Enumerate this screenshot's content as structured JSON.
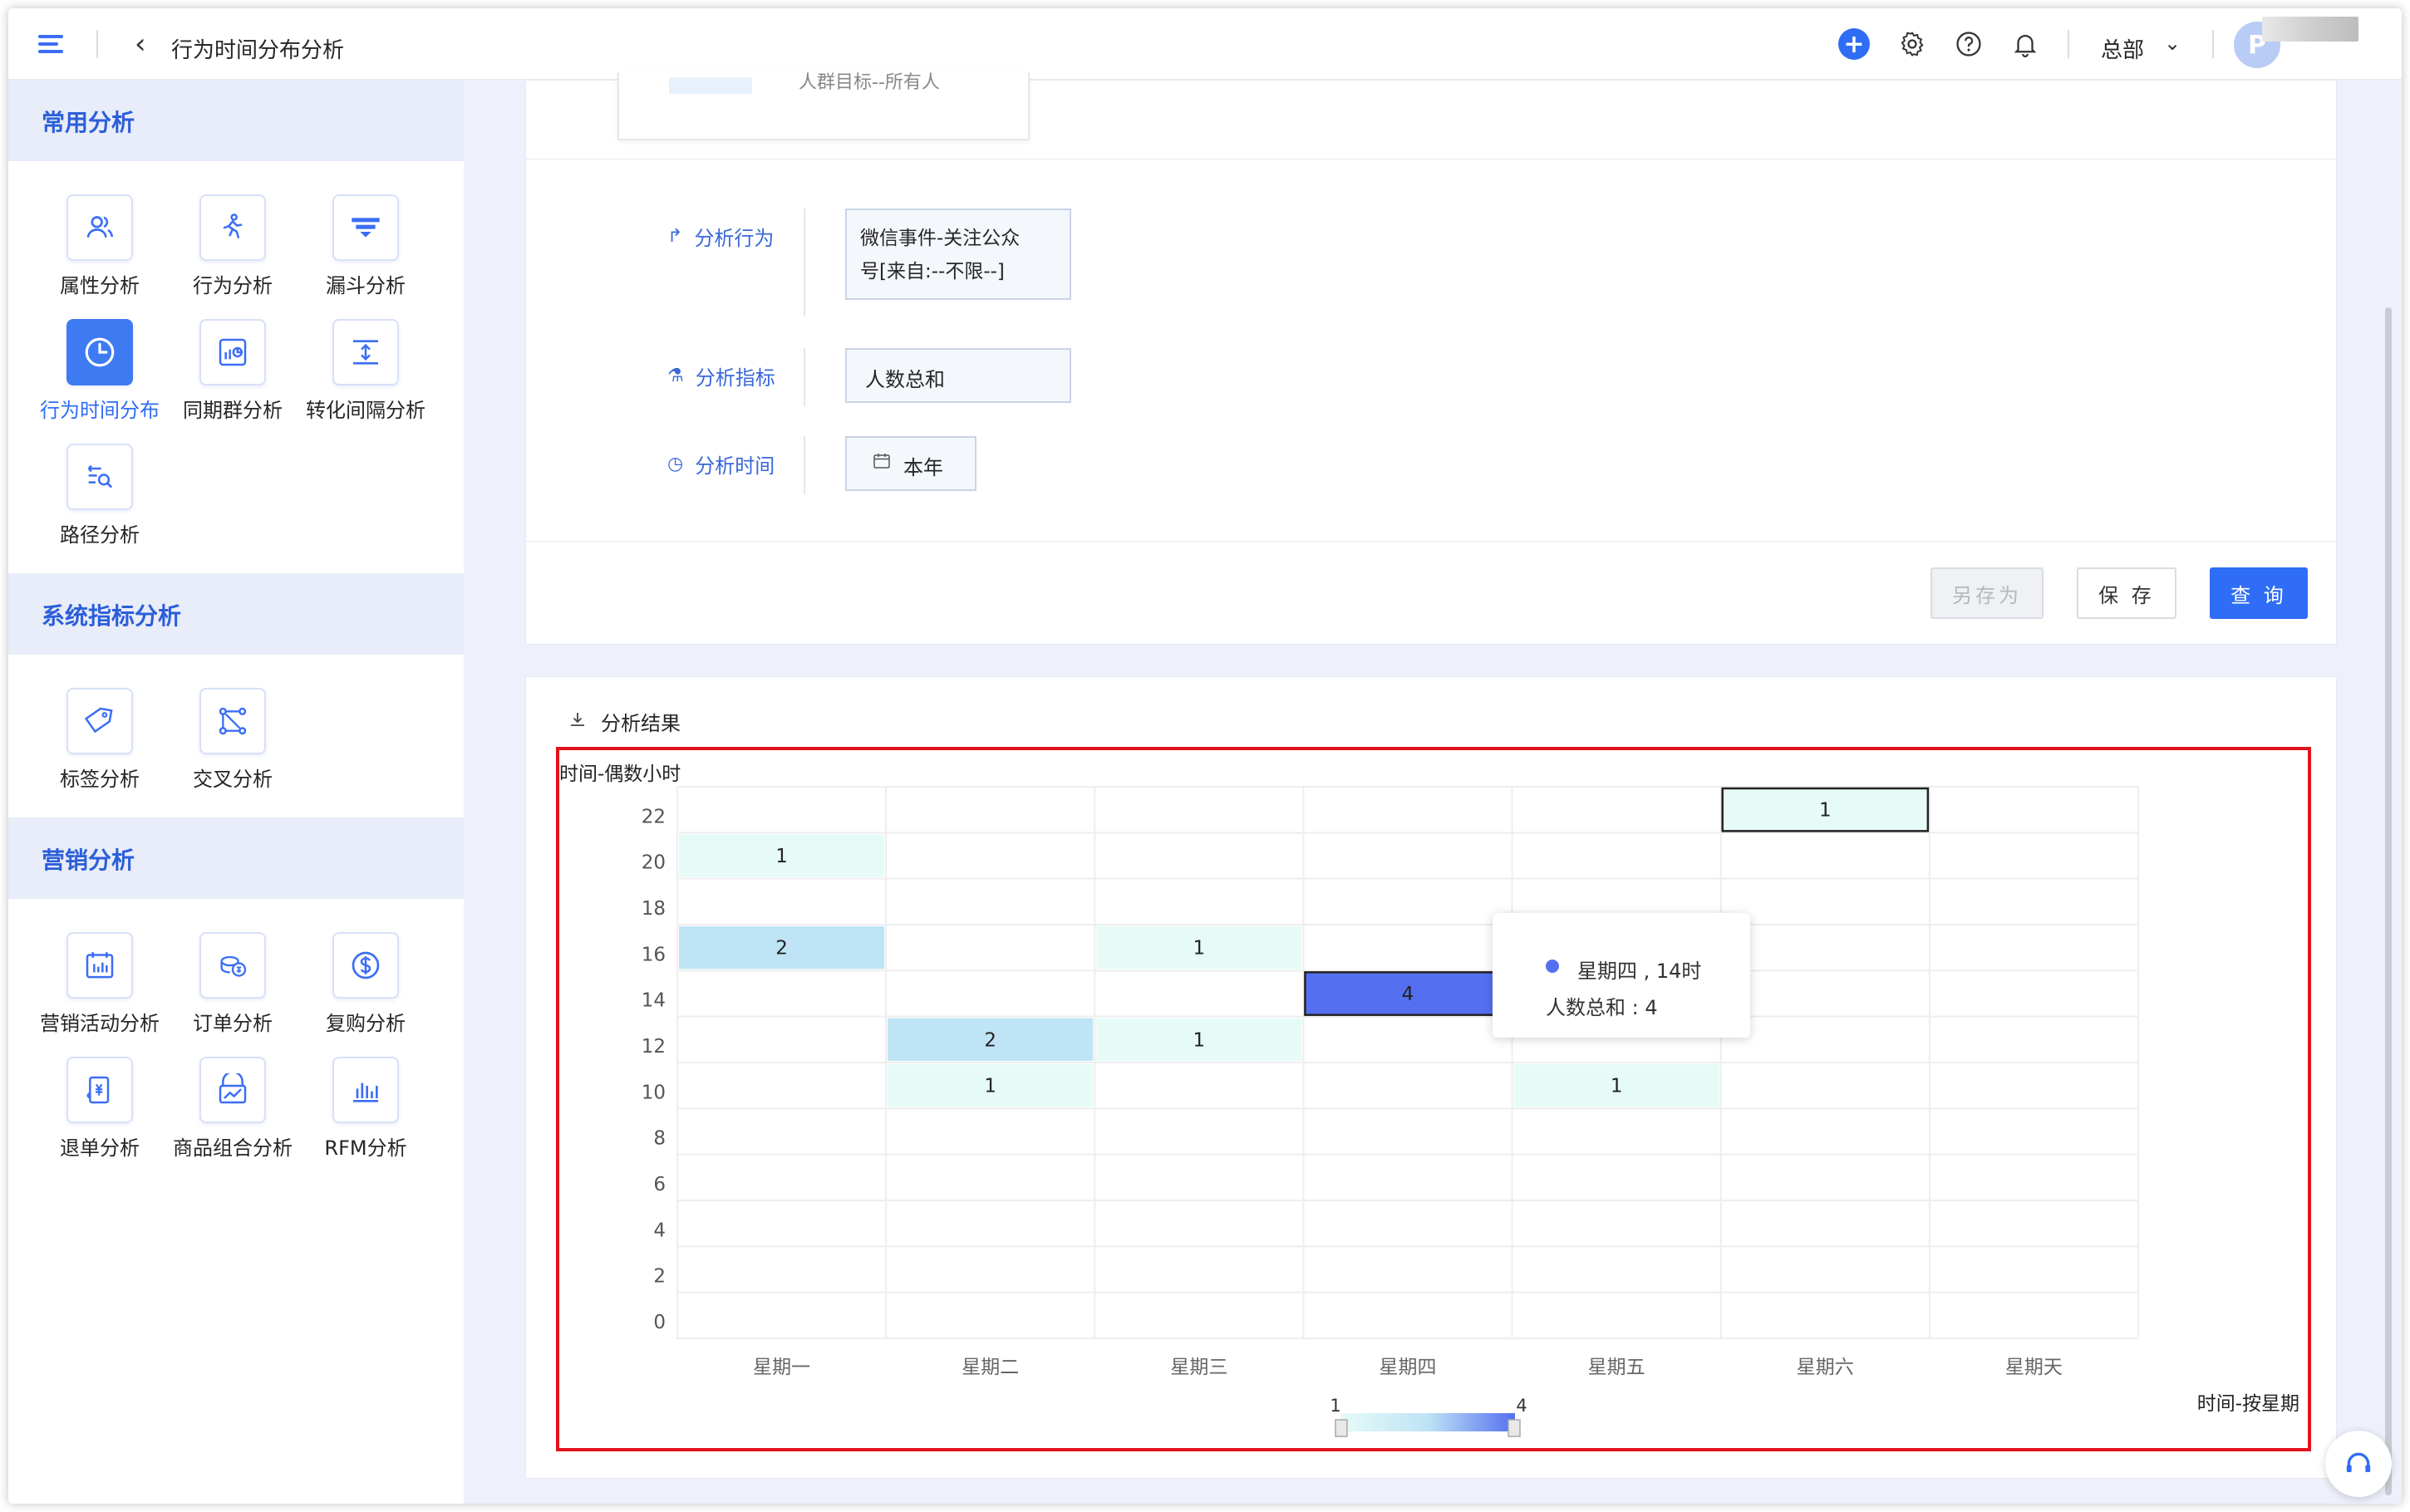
{
  "header": {
    "title": "行为时间分布分析",
    "org": "总部",
    "avatar_initial": "P"
  },
  "sidebar": {
    "sections": [
      {
        "title": "常用分析",
        "items": [
          {
            "label": "属性分析",
            "icon": "users-icon"
          },
          {
            "label": "行为分析",
            "icon": "behavior-icon"
          },
          {
            "label": "漏斗分析",
            "icon": "funnel-icon"
          },
          {
            "label": "行为时间分布",
            "icon": "clock-icon",
            "active": true
          },
          {
            "label": "同期群分析",
            "icon": "cohort-chart-icon"
          },
          {
            "label": "转化间隔分析",
            "icon": "interval-icon"
          },
          {
            "label": "路径分析",
            "icon": "path-search-icon"
          }
        ]
      },
      {
        "title": "系统指标分析",
        "items": [
          {
            "label": "标签分析",
            "icon": "tag-icon"
          },
          {
            "label": "交叉分析",
            "icon": "cross-icon"
          }
        ]
      },
      {
        "title": "营销分析",
        "items": [
          {
            "label": "营销活动分析",
            "icon": "calendar-icon"
          },
          {
            "label": "订单分析",
            "icon": "order-icon"
          },
          {
            "label": "复购分析",
            "icon": "dollar-icon"
          },
          {
            "label": "退单分析",
            "icon": "refund-icon"
          },
          {
            "label": "商品组合分析",
            "icon": "bundle-icon"
          },
          {
            "label": "RFM分析",
            "icon": "bar-chart-icon"
          }
        ]
      }
    ]
  },
  "filters": {
    "crowd_text": "人群目标--所有人",
    "behavior_label": "分析行为",
    "behavior_value_line1": "微信事件-关注公众",
    "behavior_value_line2": "号[来自:--不限--]",
    "metric_label": "分析指标",
    "metric_value": "人数总和",
    "time_label": "分析时间",
    "time_value": "本年"
  },
  "buttons": {
    "save_as": "另存为",
    "save": "保 存",
    "query": "查 询"
  },
  "result": {
    "title": "分析结果"
  },
  "chart_data": {
    "type": "heatmap",
    "ylabel": "时间-偶数小时",
    "xlabel": "时间-按星期",
    "x_categories": [
      "星期一",
      "星期二",
      "星期三",
      "星期四",
      "星期五",
      "星期六",
      "星期天"
    ],
    "y_categories": [
      "0",
      "2",
      "4",
      "6",
      "8",
      "10",
      "12",
      "14",
      "16",
      "18",
      "20",
      "22"
    ],
    "cells": [
      {
        "x": "星期六",
        "y": "22",
        "value": 1
      },
      {
        "x": "星期一",
        "y": "20",
        "value": 1
      },
      {
        "x": "星期一",
        "y": "16",
        "value": 2
      },
      {
        "x": "星期三",
        "y": "16",
        "value": 1
      },
      {
        "x": "星期四",
        "y": "14",
        "value": 4
      },
      {
        "x": "星期二",
        "y": "12",
        "value": 2
      },
      {
        "x": "星期三",
        "y": "12",
        "value": 1
      },
      {
        "x": "星期二",
        "y": "10",
        "value": 1
      },
      {
        "x": "星期五",
        "y": "10",
        "value": 1
      }
    ],
    "visual_map": {
      "min": 1,
      "max": 4,
      "colors": [
        "#e6fbf7",
        "#5470f0"
      ]
    },
    "tooltip": {
      "title": "星期四 , 14时",
      "line": "人数总和 : 4"
    }
  }
}
